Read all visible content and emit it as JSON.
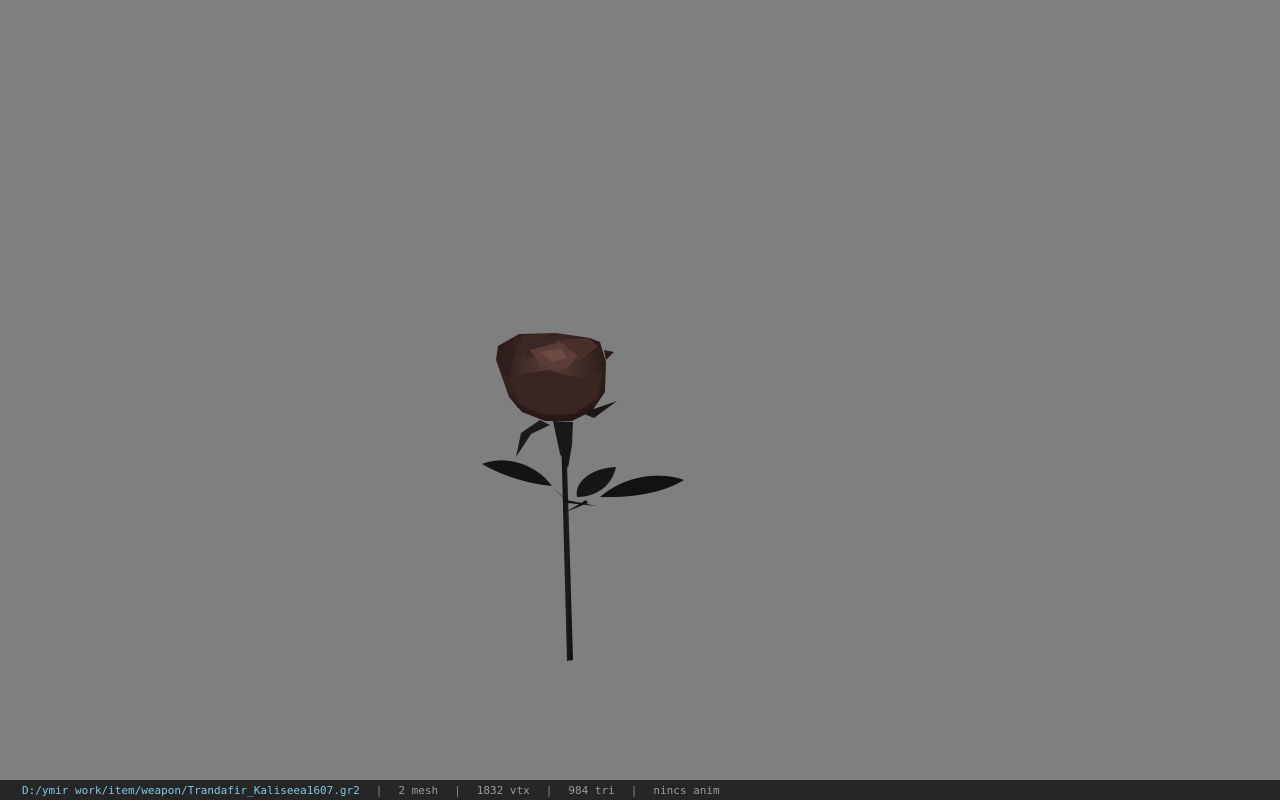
{
  "viewport": {
    "background": "#7f7f7f",
    "model": "rose-3d-model"
  },
  "status_bar": {
    "path": "D:/ymir work/item/weapon/Trandafir_Kaliseea1607.gr2",
    "separator": "|",
    "mesh": "2 mesh",
    "vertices": "1832 vtx",
    "triangles": "984 tri",
    "animation": "nincs anim",
    "path_color": "#7fc4e6"
  }
}
